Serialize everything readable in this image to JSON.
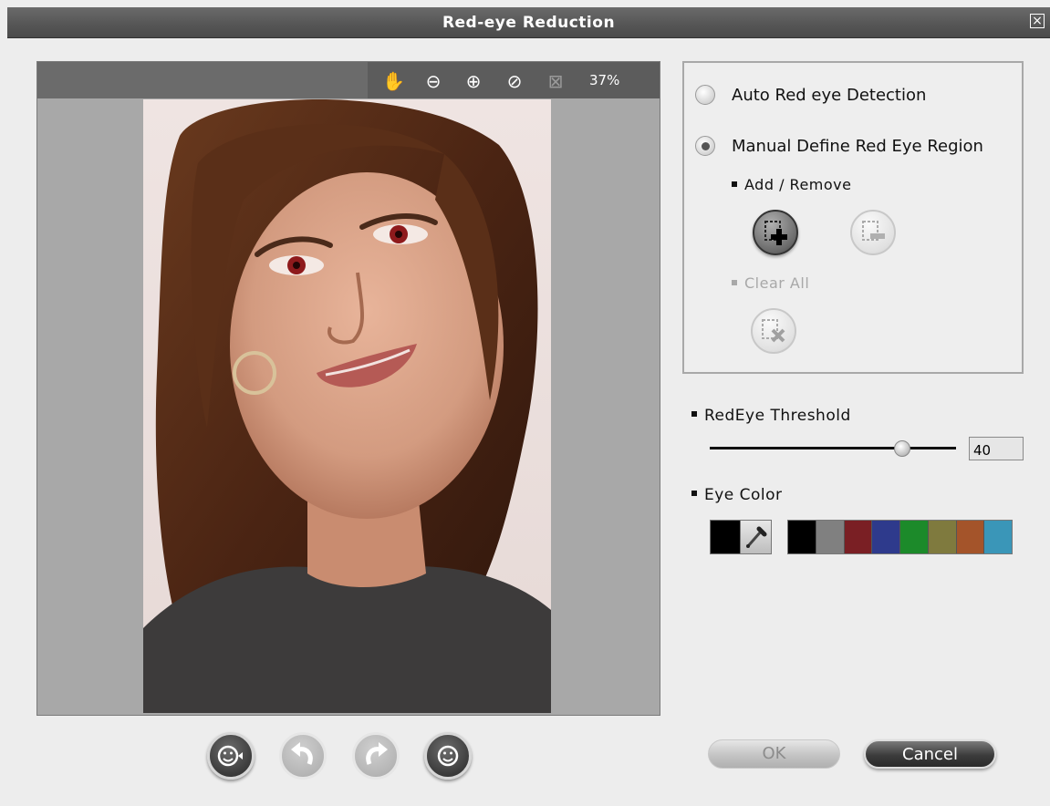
{
  "window": {
    "title": "Red-eye Reduction",
    "close_icon": "close-box-icon"
  },
  "viewer": {
    "toolbar": [
      {
        "name": "hand-pan-icon",
        "glyph": "✋",
        "enabled": true
      },
      {
        "name": "zoom-out-icon",
        "glyph": "⊖",
        "enabled": true
      },
      {
        "name": "zoom-in-icon",
        "glyph": "⊕",
        "enabled": true
      },
      {
        "name": "actual-size-icon",
        "glyph": "⊘",
        "enabled": true
      },
      {
        "name": "fit-to-window-icon",
        "glyph": "⊠",
        "enabled": false
      }
    ],
    "zoom_level": "37%"
  },
  "modes": {
    "auto_label": "Auto Red eye Detection",
    "manual_label": "Manual Define Red Eye Region",
    "selected": "manual",
    "add_remove_label": "Add / Remove",
    "clear_all_label": "Clear All"
  },
  "threshold": {
    "label": "RedEye Threshold",
    "value": "40",
    "level": 0.78
  },
  "eye_color": {
    "label": "Eye Color",
    "current": "#000000",
    "palette": [
      "#000000",
      "#808080",
      "#7a1f24",
      "#2e3a8c",
      "#1c8a2a",
      "#7f7a3e",
      "#a4542a",
      "#3a96b8"
    ]
  },
  "footer": {
    "ok_label": "OK",
    "cancel_label": "Cancel"
  }
}
